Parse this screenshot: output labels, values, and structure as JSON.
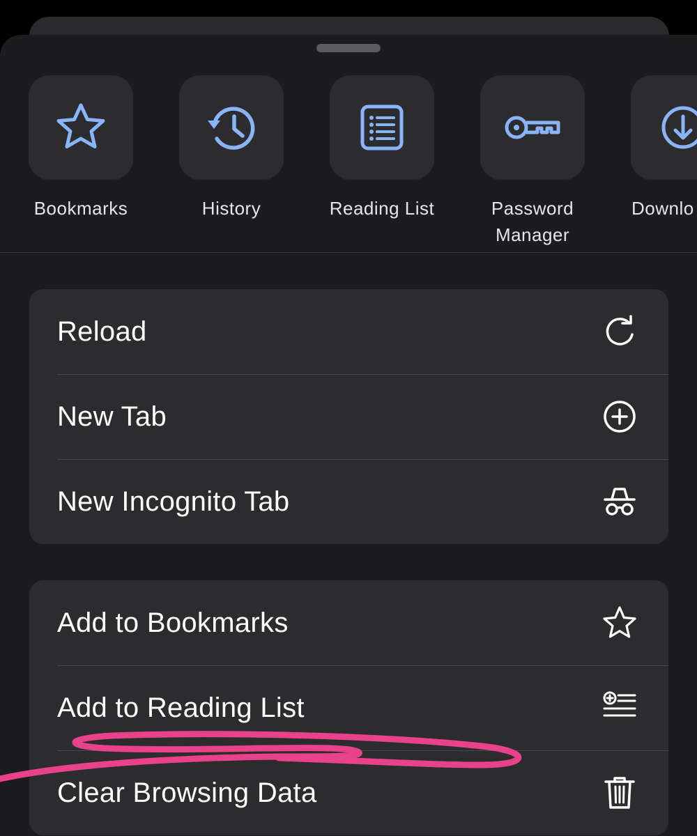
{
  "colors": {
    "background": "#000000",
    "sheet": "#1c1c1e",
    "tile": "#2c2c2e",
    "accent_blue": "#8ab4f8",
    "text_primary": "#ffffff",
    "annotation_pink": "#e8428a"
  },
  "shortcuts": [
    {
      "label": "Bookmarks",
      "icon": "star-icon"
    },
    {
      "label": "History",
      "icon": "history-icon"
    },
    {
      "label": "Reading List",
      "icon": "reading-list-icon"
    },
    {
      "label": "Password Manager",
      "icon": "key-icon"
    },
    {
      "label": "Downlo",
      "icon": "download-icon"
    }
  ],
  "menu_group_1": [
    {
      "label": "Reload",
      "icon": "reload-icon"
    },
    {
      "label": "New Tab",
      "icon": "plus-circle-icon"
    },
    {
      "label": "New Incognito Tab",
      "icon": "incognito-icon"
    }
  ],
  "menu_group_2": [
    {
      "label": "Add to Bookmarks",
      "icon": "star-outline-icon"
    },
    {
      "label": "Add to Reading List",
      "icon": "add-reading-list-icon"
    },
    {
      "label": "Clear Browsing Data",
      "icon": "trash-icon"
    }
  ]
}
